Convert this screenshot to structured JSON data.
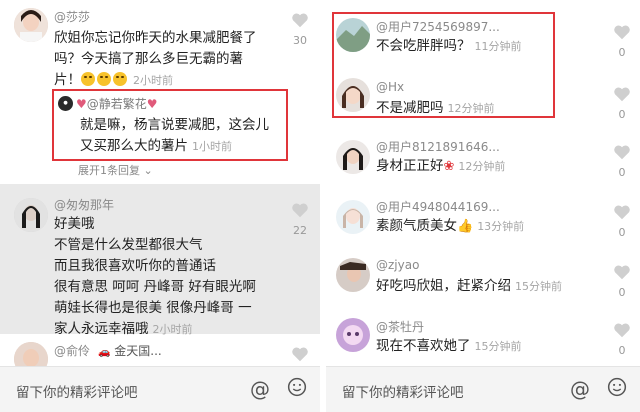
{
  "left": {
    "comments": [
      {
        "username": "@莎莎",
        "lines": [
          "欣姐你忘记你昨天的水果减肥餐了",
          "吗？今天搞了那么多巨无霸的薯",
          "片！"
        ],
        "time": "2小时前",
        "likes": "30"
      },
      {
        "username": "@匆匆那年",
        "lines": [
          "好美哦",
          "不管是什么发型都很大气",
          "而且我很喜欢听你的普通话",
          "很有意思 呵呵 丹峰哥 好有眼光啊",
          "萌娃长得也是很美 很像丹峰哥 一",
          "家人永远幸福哦"
        ],
        "time": "2小时前",
        "likes": "22"
      },
      {
        "username": "@俞伶",
        "extra": "金天国..."
      }
    ],
    "reply": {
      "username": "@静若繁花",
      "lines": [
        "就是嘛，杨言说要减肥，这会儿",
        "又买那么大的薯片"
      ],
      "time": "1小时前"
    },
    "expand_label": "展开1条回复",
    "bottom": {
      "placeholder": "留下你的精彩评论吧",
      "at_label": "@"
    }
  },
  "right": {
    "comments": [
      {
        "username": "@用户7254569897...",
        "text": "不会吃胖胖吗？",
        "time": "11分钟前",
        "likes": "0"
      },
      {
        "username": "@Hx",
        "text": "不是减肥吗",
        "time": "12分钟前",
        "likes": "0"
      },
      {
        "username": "@用户8121891646...",
        "text": "身材正正好",
        "time": "12分钟前",
        "likes": "0"
      },
      {
        "username": "@用户4948044169...",
        "text": "素颜气质美女",
        "time": "13分钟前",
        "likes": "0"
      },
      {
        "username": "@zjyao",
        "text": "好吃吗欣姐，赶紧介绍",
        "time": "15分钟前",
        "likes": "0"
      },
      {
        "username": "@茶牡丹",
        "text": "现在不喜欢她了",
        "time": "15分钟前",
        "likes": "0"
      }
    ],
    "bottom": {
      "placeholder": "留下你的精彩评论吧",
      "at_label": "@"
    }
  },
  "colors": {
    "highlight_border": "#e0353a",
    "heart": "#cfcfcf",
    "gray_bg": "#e9e9e9"
  },
  "icons": [
    "heart-icon",
    "emoji-icon",
    "at-icon",
    "rose-icon",
    "thumbs-up-icon",
    "laugh-emoji-icon"
  ]
}
